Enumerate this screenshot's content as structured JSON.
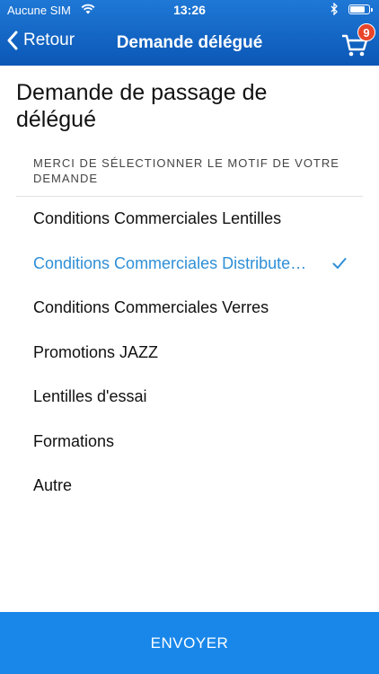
{
  "status_bar": {
    "carrier": "Aucune SIM",
    "time": "13:26"
  },
  "nav": {
    "back_label": "Retour",
    "title": "Demande délégué",
    "cart_badge": "9"
  },
  "page": {
    "title": "Demande de passage de délégué",
    "section_header": "MERCI DE SÉLECTIONNER LE MOTIF DE VOTRE DEMANDE"
  },
  "options": [
    {
      "label": "Conditions Commerciales Lentilles",
      "selected": false
    },
    {
      "label": "Conditions Commerciales Distributeurs",
      "selected": true
    },
    {
      "label": "Conditions Commerciales Verres",
      "selected": false
    },
    {
      "label": "Promotions JAZZ",
      "selected": false
    },
    {
      "label": "Lentilles d'essai",
      "selected": false
    },
    {
      "label": "Formations",
      "selected": false
    },
    {
      "label": "Autre",
      "selected": false
    }
  ],
  "submit_label": "ENVOYER",
  "colors": {
    "header": "#0b57b6",
    "accent": "#2f8fd6",
    "button": "#1987ea",
    "badge": "#e8452b"
  },
  "icons": [
    "wifi-icon",
    "bluetooth-icon",
    "battery-icon",
    "back-chevron-icon",
    "cart-icon",
    "checkmark-icon"
  ]
}
